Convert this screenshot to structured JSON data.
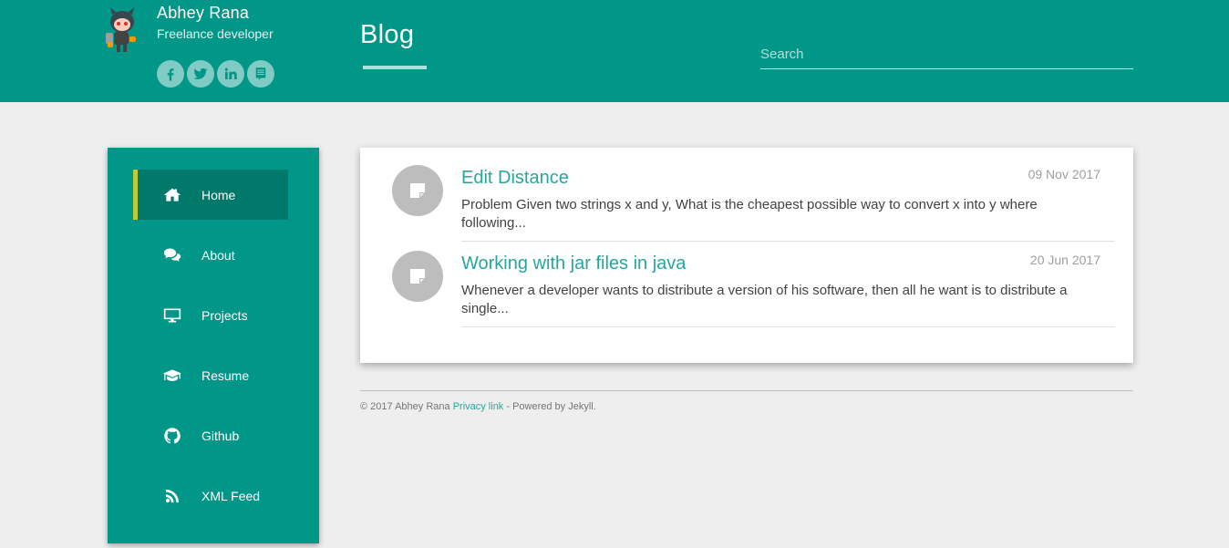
{
  "header": {
    "author_name": "Abhey Rana",
    "author_subtitle": "Freelance developer",
    "avatar_icon": "octocat-avatar",
    "social_links": [
      {
        "name": "facebook",
        "icon": "facebook-icon"
      },
      {
        "name": "twitter",
        "icon": "twitter-icon"
      },
      {
        "name": "linkedin",
        "icon": "linkedin-icon"
      },
      {
        "name": "blog",
        "icon": "blog-icon"
      }
    ],
    "page_title": "Blog",
    "search": {
      "placeholder": "Search",
      "value": ""
    }
  },
  "sidebar": {
    "items": [
      {
        "label": "Home",
        "icon": "home-icon",
        "active": true
      },
      {
        "label": "About",
        "icon": "comments-icon",
        "active": false
      },
      {
        "label": "Projects",
        "icon": "desktop-icon",
        "active": false
      },
      {
        "label": "Resume",
        "icon": "graduation-cap-icon",
        "active": false
      },
      {
        "label": "Github",
        "icon": "github-icon",
        "active": false
      },
      {
        "label": "XML Feed",
        "icon": "rss-icon",
        "active": false
      }
    ]
  },
  "posts": [
    {
      "title": "Edit Distance",
      "date": "09 Nov 2017",
      "excerpt": "Problem Given two strings x and y, What is the cheapest possible way to convert x into y where following...",
      "icon": "note-icon"
    },
    {
      "title": "Working with jar files in java",
      "date": "20 Jun 2017",
      "excerpt": "Whenever a developer wants to distribute a version of his software, then all he want is to distribute a single...",
      "icon": "note-icon"
    }
  ],
  "footer": {
    "copyright": "© 2017 Abhey Rana ",
    "privacy_link": "Privacy link",
    "powered_by": " - Powered by Jekyll."
  },
  "colors": {
    "primary": "#009688",
    "primary_dark": "#00796b",
    "accent": "#c0ca33",
    "link": "#26a69a",
    "background": "#eeeeee"
  }
}
